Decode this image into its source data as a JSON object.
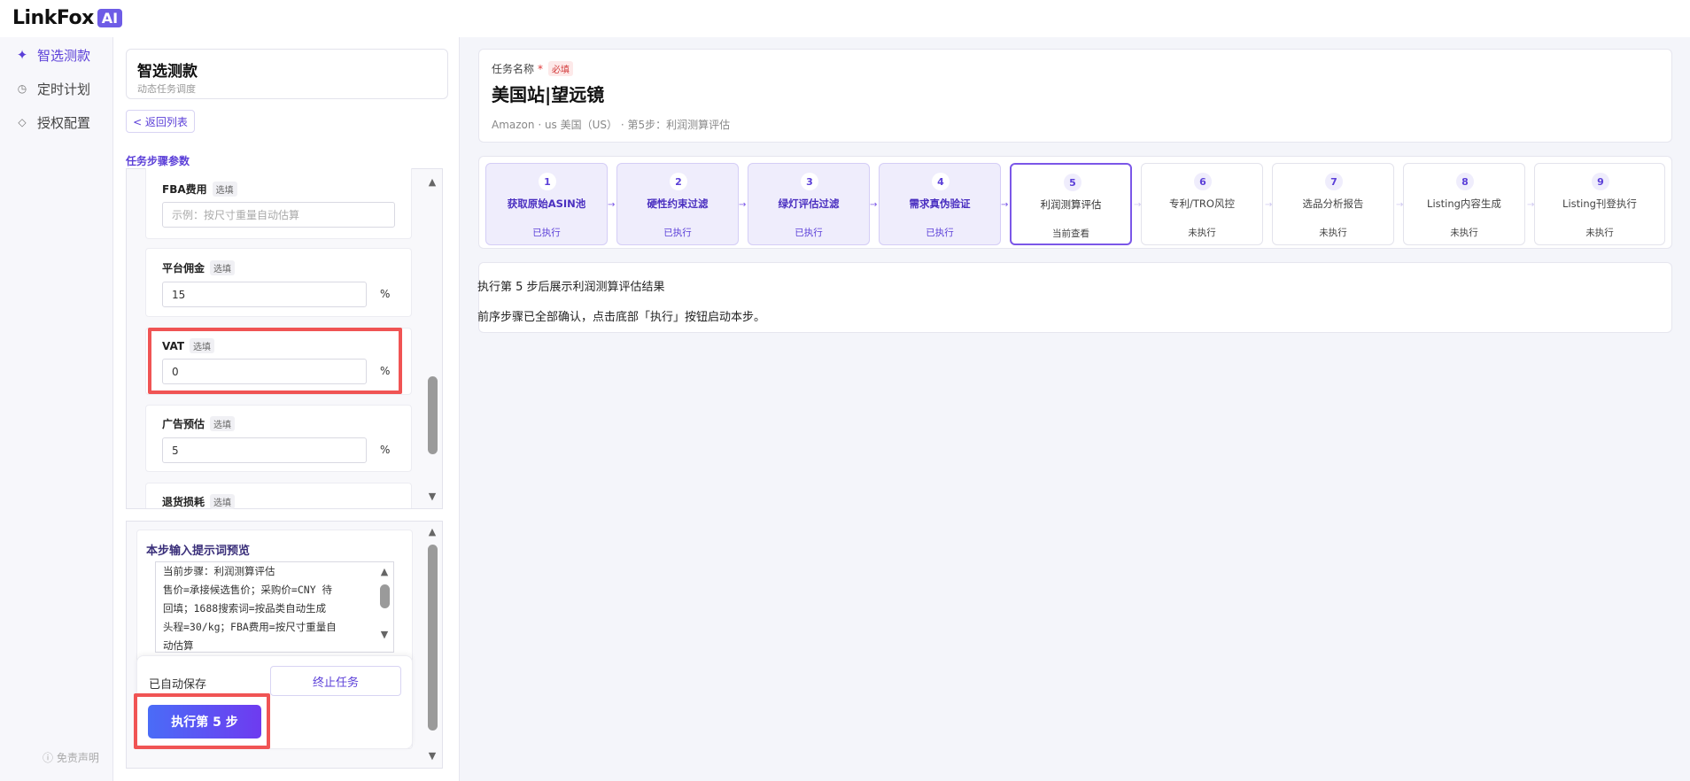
{
  "app": {
    "logo_text": "LinkFox",
    "logo_badge": "AI"
  },
  "nav": {
    "items": [
      {
        "label": "智选测款",
        "icon": "sparkle-icon",
        "active": true
      },
      {
        "label": "定时计划",
        "icon": "clock-icon",
        "active": false
      },
      {
        "label": "授权配置",
        "icon": "diamond-icon",
        "active": false
      }
    ],
    "disclaimer": "ⓘ 免责声明"
  },
  "module": {
    "title": "智选测款",
    "subtitle": "动态任务调度",
    "back_label": "< 返回列表",
    "params_label": "任务步骤参数"
  },
  "params": {
    "fba": {
      "label": "FBA费用",
      "badge": "选填",
      "placeholder": "示例：按尺寸重量自动估算"
    },
    "commission": {
      "label": "平台佣金",
      "badge": "选填",
      "value": "15",
      "unit": "%"
    },
    "vat": {
      "label": "VAT",
      "badge": "选填",
      "value": "0",
      "unit": "%"
    },
    "ads": {
      "label": "广告预估",
      "badge": "选填",
      "value": "5",
      "unit": "%"
    },
    "returns": {
      "label": "退货损耗",
      "badge": "选填"
    }
  },
  "prompt": {
    "title": "本步输入提示词预览",
    "lines": [
      "当前步骤：利润测算评估",
      "售价=承接候选售价；采购价=CNY 待",
      "回填；1688搜索词=按品类自动生成",
      "头程=30/kg；FBA费用=按尺寸重量自",
      "动估算"
    ]
  },
  "footer": {
    "autosave": "已自动保存",
    "stop_label": "终止任务",
    "run_label": "执行第 5 步"
  },
  "task": {
    "label": "任务名称",
    "required_star": "*",
    "required_badge": "必填",
    "name": "美国站|望远镜",
    "meta": "Amazon · us 美国（US） · 第5步：利润测算评估"
  },
  "steps": [
    {
      "num": "1",
      "title": "获取原始ASIN池",
      "status": "已执行",
      "state": "done"
    },
    {
      "num": "2",
      "title": "硬性约束过滤",
      "status": "已执行",
      "state": "done"
    },
    {
      "num": "3",
      "title": "绿灯评估过滤",
      "status": "已执行",
      "state": "done"
    },
    {
      "num": "4",
      "title": "需求真伪验证",
      "status": "已执行",
      "state": "done"
    },
    {
      "num": "5",
      "title": "利润测算评估",
      "status": "当前查看",
      "state": "current"
    },
    {
      "num": "6",
      "title": "专利/TRO风控",
      "status": "未执行",
      "state": "pending"
    },
    {
      "num": "7",
      "title": "选品分析报告",
      "status": "未执行",
      "state": "pending"
    },
    {
      "num": "8",
      "title": "Listing内容生成",
      "status": "未执行",
      "state": "pending"
    },
    {
      "num": "9",
      "title": "Listing刊登执行",
      "status": "未执行",
      "state": "pending"
    }
  ],
  "result": {
    "line1": "执行第 5 步后展示利润测算评估结果",
    "line2": "前序步骤已全部确认，点击底部「执行」按钮启动本步。"
  },
  "colors": {
    "accent": "#5b3fd8",
    "highlight": "#f05454",
    "run_gradient_start": "#4a6cf7",
    "run_gradient_end": "#6e3bf0"
  }
}
